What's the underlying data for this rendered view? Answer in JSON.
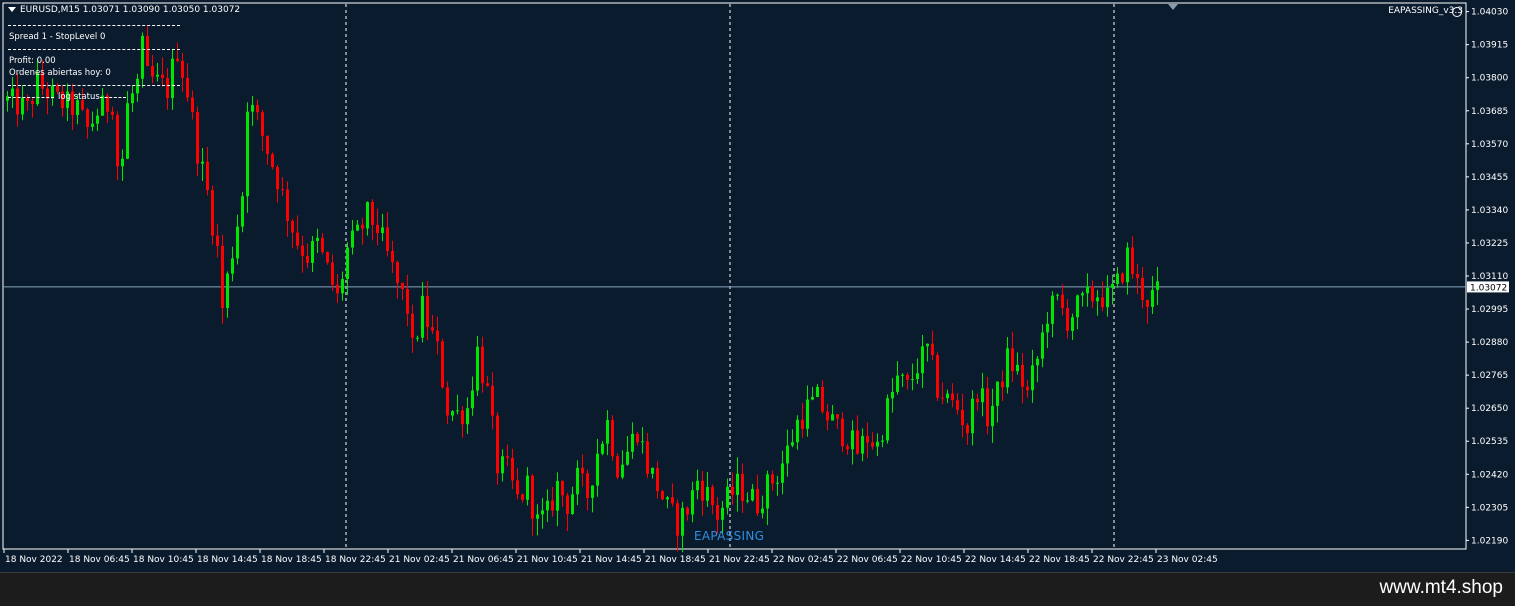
{
  "window": {
    "symbol_line": "EURUSD,M15  1.03071 1.03090 1.03050 1.03072",
    "ea_name": "EAPASSING_v3.3",
    "watermark": "EAPASSING",
    "site": "www.mt4.shop"
  },
  "overlay": {
    "spread_line": "Spread 1 - StopLevel 0",
    "profit_line": "Profit: 0.00",
    "orders_line": "Ordenes abiertas hoy: 0",
    "log_line": "log status"
  },
  "colors": {
    "background": "#0b1b2e",
    "bull": "#00e600",
    "bear": "#ff0000",
    "price_line": "#8aa3b8",
    "separator": "#ffffff",
    "watermark": "#2e8fe0"
  },
  "chart_data": {
    "type": "candlestick",
    "symbol": "EURUSD",
    "timeframe": "M15",
    "current_price": "1.03072",
    "ylim": [
      1.0216,
      1.0406
    ],
    "price_ticks": [
      "1.04030",
      "1.03915",
      "1.03800",
      "1.03685",
      "1.03570",
      "1.03455",
      "1.03340",
      "1.03225",
      "1.03110",
      "1.02995",
      "1.02880",
      "1.02765",
      "1.02650",
      "1.02535",
      "1.02420",
      "1.02305",
      "1.02190"
    ],
    "time_ticks": [
      "18 Nov 2022",
      "18 Nov 06:45",
      "18 Nov 10:45",
      "18 Nov 14:45",
      "18 Nov 18:45",
      "18 Nov 22:45",
      "21 Nov 02:45",
      "21 Nov 06:45",
      "21 Nov 10:45",
      "21 Nov 14:45",
      "21 Nov 18:45",
      "21 Nov 22:45",
      "22 Nov 02:45",
      "22 Nov 06:45",
      "22 Nov 10:45",
      "22 Nov 14:45",
      "22 Nov 18:45",
      "22 Nov 22:45",
      "23 Nov 02:45"
    ],
    "close_path": [
      [
        0,
        1.0372
      ],
      [
        4,
        1.0369
      ],
      [
        6,
        1.0378
      ],
      [
        10,
        1.0372
      ],
      [
        14,
        1.0369
      ],
      [
        16,
        1.0362
      ],
      [
        18,
        1.0368
      ],
      [
        21,
        1.0372
      ],
      [
        22,
        1.035
      ],
      [
        23,
        1.0352
      ],
      [
        24,
        1.037
      ],
      [
        26,
        1.0378
      ],
      [
        27,
        1.039
      ],
      [
        28,
        1.038
      ],
      [
        32,
        1.0376
      ],
      [
        34,
        1.039
      ],
      [
        36,
        1.0375
      ],
      [
        38,
        1.0355
      ],
      [
        40,
        1.034
      ],
      [
        42,
        1.032
      ],
      [
        43,
        1.03
      ],
      [
        45,
        1.032
      ],
      [
        47,
        1.034
      ],
      [
        48,
        1.0372
      ],
      [
        50,
        1.0365
      ],
      [
        52,
        1.0355
      ],
      [
        54,
        1.0345
      ],
      [
        56,
        1.0333
      ],
      [
        58,
        1.0323
      ],
      [
        60,
        1.0318
      ],
      [
        62,
        1.0322
      ],
      [
        64,
        1.0313
      ],
      [
        66,
        1.0303
      ],
      [
        68,
        1.032
      ],
      [
        70,
        1.0325
      ],
      [
        72,
        1.0332
      ],
      [
        74,
        1.0328
      ],
      [
        76,
        1.0318
      ],
      [
        78,
        1.0308
      ],
      [
        80,
        1.03
      ],
      [
        81,
        1.0285
      ],
      [
        83,
        1.03
      ],
      [
        84,
        1.0295
      ],
      [
        86,
        1.0285
      ],
      [
        88,
        1.0265
      ],
      [
        90,
        1.0263
      ],
      [
        92,
        1.0265
      ],
      [
        94,
        1.0285
      ],
      [
        96,
        1.027
      ],
      [
        98,
        1.0245
      ],
      [
        100,
        1.0243
      ],
      [
        102,
        1.0233
      ],
      [
        104,
        1.0238
      ],
      [
        106,
        1.0225
      ],
      [
        108,
        1.0228
      ],
      [
        110,
        1.0238
      ],
      [
        112,
        1.0232
      ],
      [
        114,
        1.024
      ],
      [
        116,
        1.0235
      ],
      [
        118,
        1.025
      ],
      [
        120,
        1.026
      ],
      [
        122,
        1.0245
      ],
      [
        124,
        1.025
      ],
      [
        126,
        1.0258
      ],
      [
        128,
        1.0245
      ],
      [
        130,
        1.0238
      ],
      [
        132,
        1.023
      ],
      [
        134,
        1.0225
      ],
      [
        136,
        1.023
      ],
      [
        138,
        1.024
      ],
      [
        140,
        1.0235
      ],
      [
        142,
        1.0228
      ],
      [
        144,
        1.0233
      ],
      [
        146,
        1.0238
      ],
      [
        148,
        1.0235
      ],
      [
        150,
        1.0232
      ],
      [
        152,
        1.0238
      ],
      [
        154,
        1.0242
      ],
      [
        156,
        1.025
      ],
      [
        158,
        1.026
      ],
      [
        160,
        1.0265
      ],
      [
        162,
        1.0268
      ],
      [
        164,
        1.0262
      ],
      [
        166,
        1.0258
      ],
      [
        168,
        1.0255
      ],
      [
        170,
        1.025
      ],
      [
        172,
        1.0255
      ],
      [
        174,
        1.0252
      ],
      [
        176,
        1.0265
      ],
      [
        178,
        1.0275
      ],
      [
        180,
        1.0272
      ],
      [
        182,
        1.028
      ],
      [
        184,
        1.0285
      ],
      [
        186,
        1.0272
      ],
      [
        188,
        1.0268
      ],
      [
        190,
        1.0265
      ],
      [
        192,
        1.0258
      ],
      [
        194,
        1.0272
      ],
      [
        196,
        1.0262
      ],
      [
        198,
        1.027
      ],
      [
        200,
        1.0282
      ],
      [
        202,
        1.0278
      ],
      [
        204,
        1.027
      ],
      [
        206,
        1.0282
      ],
      [
        208,
        1.0298
      ],
      [
        210,
        1.0302
      ],
      [
        212,
        1.0296
      ],
      [
        214,
        1.03
      ],
      [
        216,
        1.0303
      ],
      [
        218,
        1.0305
      ],
      [
        220,
        1.0303
      ],
      [
        222,
        1.0308
      ],
      [
        224,
        1.0318
      ],
      [
        226,
        1.0308
      ],
      [
        228,
        1.0303
      ],
      [
        230,
        1.0305
      ]
    ],
    "bars": 231
  }
}
